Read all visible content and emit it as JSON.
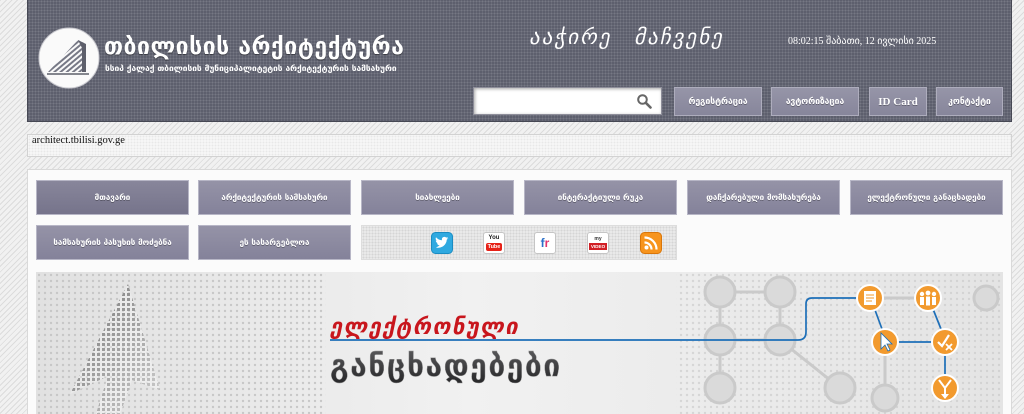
{
  "colors": {
    "header_bg": "#5c5e6c",
    "menu_button_bg": "#8c8aa0",
    "banner_red": "#c8161d",
    "banner_dark": "#3a3a3c",
    "circuit_blue": "#1d6fb8",
    "circuit_orange": "#f29a2e"
  },
  "header": {
    "logo_icon": "building-logo-icon",
    "site_title": "თბილისის არქიტექტურა",
    "site_subtitle": "სსიპ ქალაქ თბილისის მუნიციპალიტეტის არქიტექტურის სამსახური",
    "tagline": "ააჭირე მაჩვენე",
    "datetime": "08:02:15 შაბათი, 12 ივლისი 2025",
    "search": {
      "value": "",
      "icon": "search-icon"
    },
    "buttons": [
      {
        "label": "რეგისტრაცია"
      },
      {
        "label": "ავტორიზაცია"
      },
      {
        "label": "ID Card"
      },
      {
        "label": "კონტაქტი"
      }
    ]
  },
  "address_bar": {
    "text": "architect.tbilisi.gov.ge"
  },
  "menu": {
    "items": [
      {
        "label": "მთავარი"
      },
      {
        "label": "არქიტექტურის სამსახური"
      },
      {
        "label": "სიახლეები"
      },
      {
        "label": "ინტერაქტიული რუკა"
      },
      {
        "label": "დაჩქარებული მომსახურება"
      },
      {
        "label": "ელექტრონული განაცხადები"
      },
      {
        "label": "სამსახურის პასუხის მოძებნა"
      },
      {
        "label": "ეს სასარგებლოა"
      }
    ]
  },
  "social": {
    "icons": [
      {
        "icon": "twitter-icon"
      },
      {
        "icon": "youtube-icon",
        "text_top": "You",
        "text_bottom": "Tube"
      },
      {
        "icon": "fr-icon",
        "text": "fr"
      },
      {
        "icon": "myvideo-icon",
        "text_top": "my",
        "text_bottom": "VIDEO"
      },
      {
        "icon": "rss-icon"
      }
    ]
  },
  "banner": {
    "line1": "ელექტრონული",
    "line2": "განცხადებები",
    "icons": [
      "document-icon",
      "people-icon",
      "cursor-icon",
      "check-cross-icon",
      "fork-arrow-icon"
    ]
  }
}
